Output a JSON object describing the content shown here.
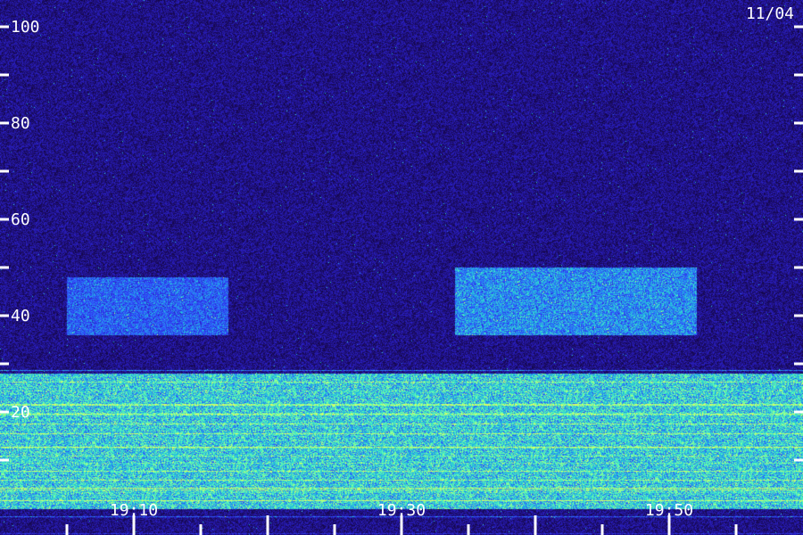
{
  "date_label": "11/04",
  "chart_data": {
    "type": "heatmap",
    "y_ticks": [
      100,
      80,
      60,
      40,
      20
    ],
    "y_minor_ticks": [
      90,
      70,
      50,
      30,
      10
    ],
    "ylim": [
      0,
      100
    ],
    "x_tick_labels": [
      "19:10",
      "19:30",
      "19:50"
    ],
    "x_range": [
      "19:00",
      "20:00"
    ],
    "colormap": [
      "#000010",
      "#1a0a5c",
      "#2a20c8",
      "#3050ff",
      "#20c0e0",
      "#60ffb0",
      "#e0ff60"
    ],
    "background": "#000000",
    "axis_color": "#ffffff",
    "bands": [
      {
        "range": [
          36,
          48
        ],
        "start": "19:05",
        "end": "19:17",
        "level": 0.35
      },
      {
        "range": [
          36,
          50
        ],
        "start": "19:34",
        "end": "19:52",
        "level": 0.45
      },
      {
        "range": [
          0,
          28
        ],
        "start": "19:00",
        "end": "20:00",
        "level": 0.6
      }
    ]
  }
}
